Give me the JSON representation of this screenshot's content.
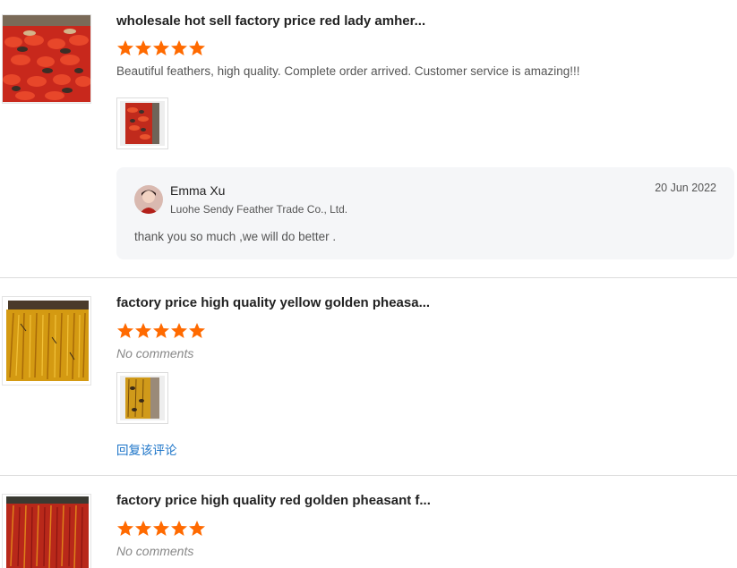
{
  "colors": {
    "star": "#ff6a00",
    "link": "#1a73c8",
    "reply_bg": "#f5f6f8",
    "divider": "#dcdcdc"
  },
  "reviews": [
    {
      "title": "wholesale hot sell factory price red lady amher...",
      "rating": 5,
      "comment": "Beautiful feathers, high quality.  Complete order arrived.  Customer service is amazing!!!",
      "product_icon": "red-feather-trim-image",
      "reply": {
        "name": "Emma Xu",
        "company": "Luohe Sendy Feather Trade Co., Ltd.",
        "date": "20 Jun 2022",
        "text": "thank you so much ,we will do better ."
      }
    },
    {
      "title": "factory price high quality yellow golden pheasa...",
      "rating": 5,
      "comment": "No comments",
      "product_icon": "yellow-feather-trim-image",
      "reply_link": "回复该评论"
    },
    {
      "title": "factory price high quality red golden pheasant f...",
      "rating": 5,
      "comment": "No comments",
      "product_icon": "red-golden-feather-trim-image"
    }
  ]
}
